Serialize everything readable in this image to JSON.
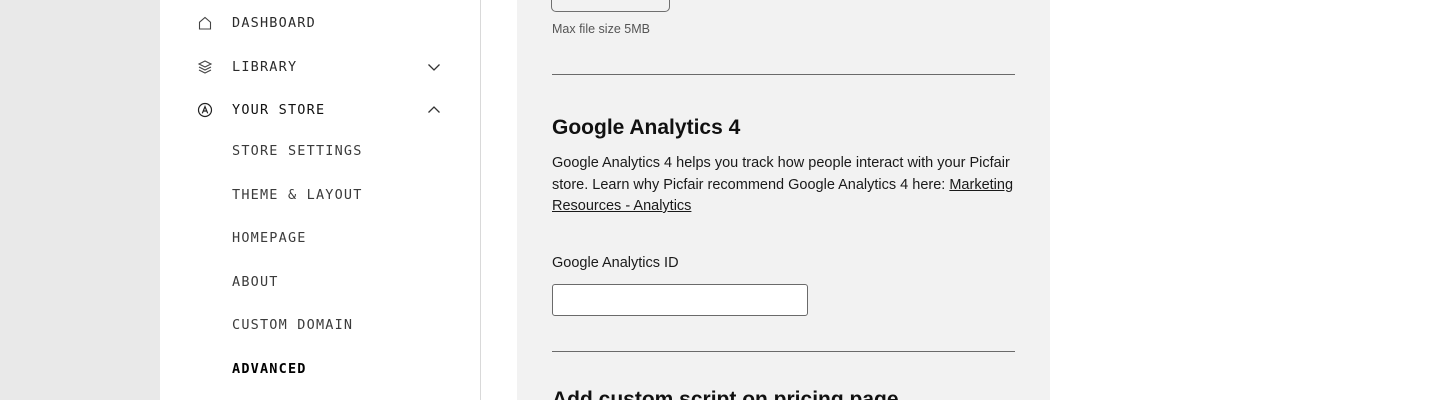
{
  "sidebar": {
    "items": [
      {
        "label": "DASHBOARD",
        "icon": "home-icon"
      },
      {
        "label": "LIBRARY",
        "icon": "layers-icon",
        "expanded": false
      },
      {
        "label": "YOUR STORE",
        "icon": "store-icon",
        "expanded": true
      }
    ],
    "store_submenu": [
      {
        "label": "STORE SETTINGS"
      },
      {
        "label": "THEME & LAYOUT"
      },
      {
        "label": "HOMEPAGE"
      },
      {
        "label": "ABOUT"
      },
      {
        "label": "CUSTOM DOMAIN"
      },
      {
        "label": "ADVANCED",
        "current": true
      }
    ]
  },
  "upload": {
    "hint": "Max file size 5MB"
  },
  "analytics": {
    "title": "Google Analytics 4",
    "description": "Google Analytics 4 helps you track how people interact with your Picfair store. Learn why Picfair recommend Google Analytics 4 here:",
    "link_label": "Marketing Resources - Analytics",
    "field_label": "Google Analytics ID",
    "field_value": "",
    "field_placeholder": ""
  },
  "next_section": {
    "title": "Add custom script on pricing page"
  },
  "colors": {
    "page_bg": "#e9e9e9",
    "panel_bg": "#f2f2f2",
    "sidebar_bg": "#ffffff",
    "text": "#1a1a1a"
  }
}
